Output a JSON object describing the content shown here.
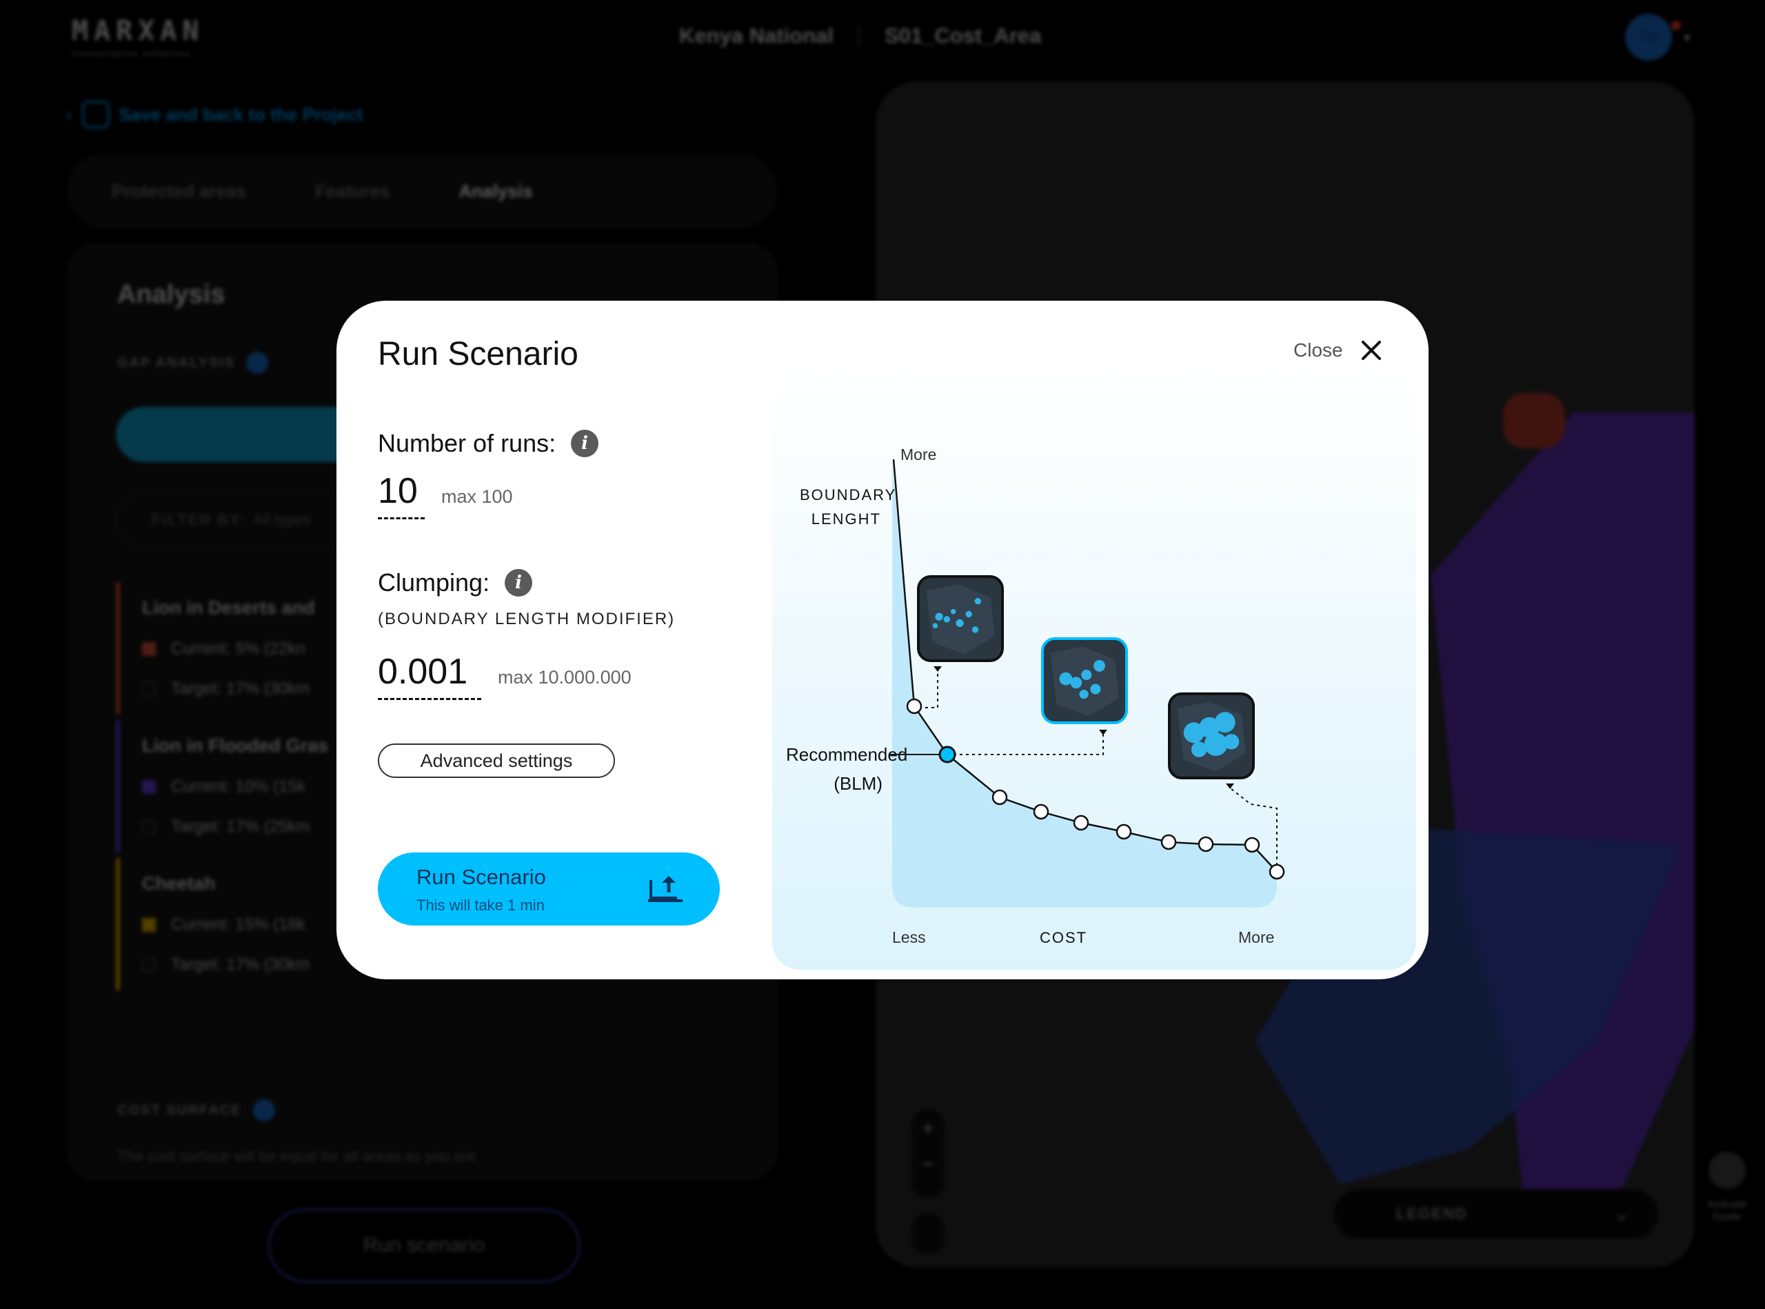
{
  "app": {
    "logo": "MARXAN",
    "logo_tagline": "conservation solutions",
    "breadcrumb": [
      "Kenya National",
      "S01_Cost_Area"
    ],
    "user_initials": "TH",
    "back_link": "Save and back to the Project",
    "tabs": [
      {
        "label": "Protected areas",
        "active": false
      },
      {
        "label": "Features",
        "active": false
      },
      {
        "label": "Analysis",
        "active": true
      }
    ],
    "panel": {
      "title": "Analysis",
      "gap_analysis_label": "GAP ANALYSIS",
      "filter_label": "FILTER BY:",
      "filter_value": "All types",
      "features": [
        {
          "name": "Lion in Deserts and",
          "current": "Current: 5% (22kn",
          "target": "Target: 17% (30km",
          "color": "#e0533a"
        },
        {
          "name": "Lion in Flooded Gras",
          "current": "Current: 10% (15k",
          "target": "Target: 17% (25km",
          "color": "#6b3ee0"
        },
        {
          "name": "Cheetah",
          "current": "Current: 15% (18k",
          "target": "Target: 17% (30km",
          "color": "#e8b400"
        }
      ],
      "cost_surface_label": "COST SURFACE",
      "cost_surface_text": "The cost surface will be equal for all areas as you are"
    },
    "run_button": "Run scenario",
    "map": {
      "legend_label": "LEGEND",
      "guide_label": "Activate Guide"
    }
  },
  "modal": {
    "title": "Run Scenario",
    "close_label": "Close",
    "runs": {
      "label": "Number of runs:",
      "value": "10",
      "max": "max 100"
    },
    "clumping": {
      "label": "Clumping:",
      "caption": "(BOUNDARY LENGTH MODIFIER)",
      "value": "0.001",
      "max": "max 10.000.000"
    },
    "advanced_button": "Advanced settings",
    "run_button": {
      "label": "Run Scenario",
      "subtitle": "This will take 1 min"
    },
    "chart": {
      "y_more": "More",
      "y_axis_label": [
        "BOUNDARY",
        "LENGHT"
      ],
      "recommended_label": [
        "Recommended",
        "(BLM)"
      ],
      "x_less": "Less",
      "x_axis_label": "COST",
      "x_more": "More",
      "accent_color": "#00bfff"
    }
  }
}
